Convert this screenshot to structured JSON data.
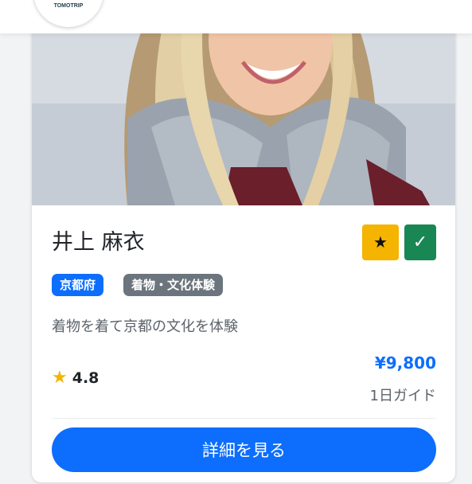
{
  "header": {
    "logo_text": "TOMOTRIP"
  },
  "guide": {
    "name": "井上 麻衣",
    "badges": {
      "featured": "★",
      "verified": "✓"
    },
    "tags": {
      "region": "京都府",
      "category": "着物・文化体験"
    },
    "description": "着物を着て京都の文化を体験",
    "rating": "4.8",
    "price": "¥9,800",
    "price_unit": "1日ガイド",
    "detail_button": "詳細を見る"
  },
  "colors": {
    "primary": "#0d6efd",
    "star_badge": "#f4b400",
    "verified_badge": "#198754",
    "tag_gray": "#6c757d"
  }
}
